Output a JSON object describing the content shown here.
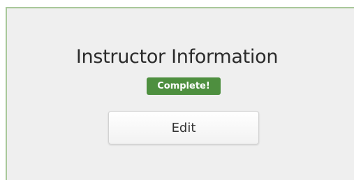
{
  "card": {
    "title": "Instructor Information",
    "status_badge": "Complete!",
    "edit_label": "Edit"
  },
  "colors": {
    "card_background": "#efefef",
    "card_border": "#a9c89a",
    "badge_background": "#4e8f3f",
    "badge_text": "#ffffff",
    "title_text": "#2b2b2b"
  }
}
